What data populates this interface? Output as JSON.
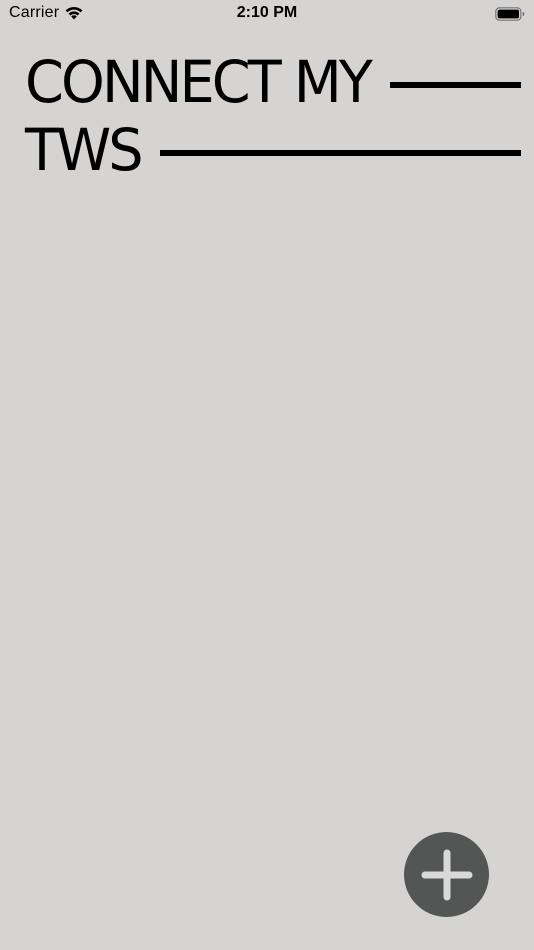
{
  "status_bar": {
    "carrier": "Carrier",
    "time": "2:10 PM",
    "wifi_icon": "wifi-icon",
    "battery_icon": "battery-full-icon"
  },
  "header": {
    "title_line1": "CONNECT MY",
    "title_line2": "TWS"
  },
  "fab": {
    "icon": "plus-icon",
    "color": "#545655"
  },
  "colors": {
    "background": "#d5d4d3",
    "text": "#000000"
  }
}
